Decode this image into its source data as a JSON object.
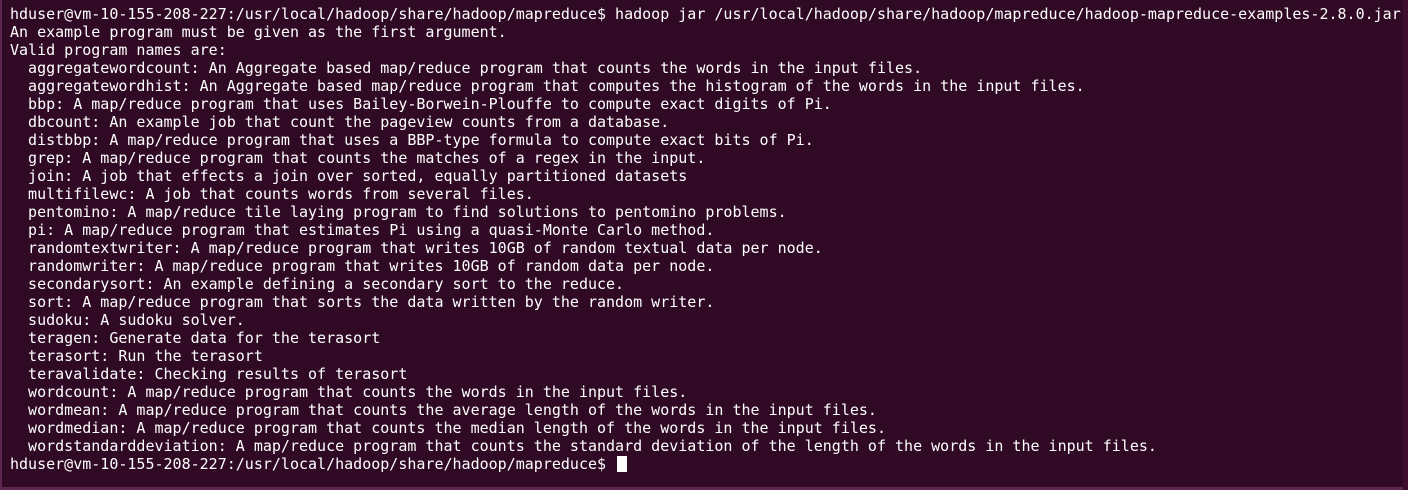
{
  "terminal": {
    "background": "#300a24",
    "text_color": "#ffffff",
    "lines": [
      "hduser@vm-10-155-208-227:/usr/local/hadoop/share/hadoop/mapreduce$ hadoop jar /usr/local/hadoop/share/hadoop/mapreduce/hadoop-mapreduce-examples-2.8.0.jar",
      "An example program must be given as the first argument.",
      "Valid program names are:",
      "  aggregatewordcount: An Aggregate based map/reduce program that counts the words in the input files.",
      "  aggregatewordhist: An Aggregate based map/reduce program that computes the histogram of the words in the input files.",
      "  bbp: A map/reduce program that uses Bailey-Borwein-Plouffe to compute exact digits of Pi.",
      "  dbcount: An example job that count the pageview counts from a database.",
      "  distbbp: A map/reduce program that uses a BBP-type formula to compute exact bits of Pi.",
      "  grep: A map/reduce program that counts the matches of a regex in the input.",
      "  join: A job that effects a join over sorted, equally partitioned datasets",
      "  multifilewc: A job that counts words from several files.",
      "  pentomino: A map/reduce tile laying program to find solutions to pentomino problems.",
      "  pi: A map/reduce program that estimates Pi using a quasi-Monte Carlo method.",
      "  randomtextwriter: A map/reduce program that writes 10GB of random textual data per node.",
      "  randomwriter: A map/reduce program that writes 10GB of random data per node.",
      "  secondarysort: An example defining a secondary sort to the reduce.",
      "  sort: A map/reduce program that sorts the data written by the random writer.",
      "  sudoku: A sudoku solver.",
      "  teragen: Generate data for the terasort",
      "  terasort: Run the terasort",
      "  teravalidate: Checking results of terasort",
      "  wordcount: A map/reduce program that counts the words in the input files.",
      "  wordmean: A map/reduce program that counts the average length of the words in the input files.",
      "  wordmedian: A map/reduce program that counts the median length of the words in the input files.",
      "  wordstandarddeviation: A map/reduce program that counts the standard deviation of the length of the words in the input files."
    ],
    "prompt": "hduser@vm-10-155-208-227:/usr/local/hadoop/share/hadoop/mapreduce$ "
  }
}
